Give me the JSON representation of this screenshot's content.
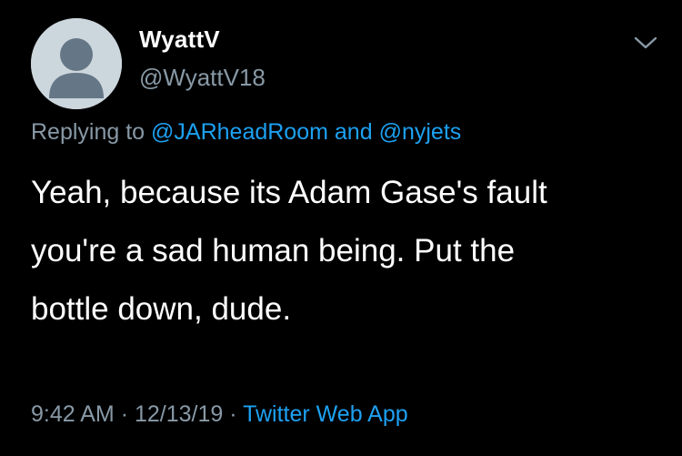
{
  "tweet": {
    "author": {
      "name": "WyattV",
      "handle": "@WyattV18",
      "avatar_icon": "default-avatar-icon"
    },
    "menu_icon": "chevron-down-icon",
    "reply": {
      "prefix": "Replying to",
      "mention1": "@JARheadRoom",
      "conjunction": "and",
      "mention2": "@nyjets"
    },
    "text_lines": [
      "Yeah, because its Adam Gase's fault",
      "you're a sad human being. Put the",
      "bottle down, dude."
    ],
    "time": "9:42 AM",
    "separator": "·",
    "date": "12/13/19",
    "source": "Twitter Web App"
  },
  "colors": {
    "background": "#000000",
    "text": "#ffffff",
    "muted": "#8899a6",
    "link": "#1da1f2",
    "avatar_bg": "#ccd6dd",
    "avatar_fg": "#657786"
  }
}
